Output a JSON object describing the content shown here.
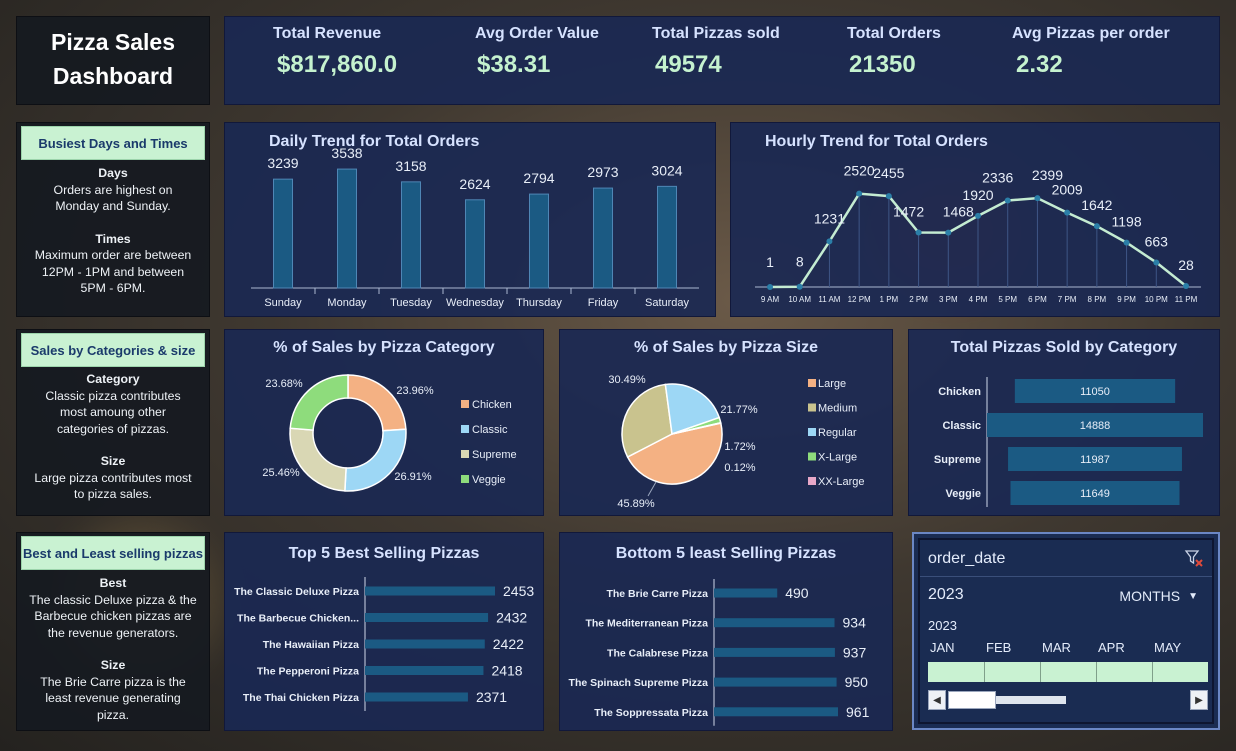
{
  "header": {
    "title_line1": "Pizza Sales",
    "title_line2": "Dashboard"
  },
  "kpis": [
    {
      "label": "Total Revenue",
      "value": "$817,860.0"
    },
    {
      "label": "Avg Order Value",
      "value": "$38.31"
    },
    {
      "label": "Total Pizzas sold",
      "value": "49574"
    },
    {
      "label": "Total Orders",
      "value": "21350"
    },
    {
      "label": "Avg Pizzas per order",
      "value": "2.32"
    }
  ],
  "insights": {
    "busiest": {
      "tag": "Busiest Days and Times",
      "h1": "Days",
      "t1": "Orders are highest on Monday and Sunday.",
      "h2": "Times",
      "t2": "Maximum order are  between 12PM - 1PM and between 5PM - 6PM."
    },
    "categories": {
      "tag": "Sales by Categories & size",
      "h1": "Category",
      "t1": "Classic pizza contributes most amoung other categories of pizzas.",
      "h2": "Size",
      "t2": "Large pizza contributes most to pizza sales."
    },
    "best_least": {
      "tag": "Best and Least selling pizzas",
      "h1": "Best",
      "t1": "The classic Deluxe pizza & the Barbecue chicken pizzas are the revenue generators.",
      "h2": "Size",
      "t2": "The Brie Carre pizza is the least revenue generating pizza."
    }
  },
  "colors": {
    "bar": "#1b5a83",
    "bar_edge": "#4f86b5",
    "line": "#c4ecd2",
    "point": "#2b7fa8",
    "chicken": "#f4b183",
    "classic": "#9dd7f5",
    "supreme": "#d9d7b4",
    "veggie": "#8edc7c",
    "large": "#f4b183",
    "medium": "#c9c38e",
    "regular": "#9dd7f5",
    "xlarge": "#8edc7c",
    "xxlarge": "#e8a8c8"
  },
  "chart_data": [
    {
      "id": "daily",
      "type": "bar",
      "title": "Daily Trend for Total Orders",
      "categories": [
        "Sunday",
        "Monday",
        "Tuesday",
        "Wednesday",
        "Thursday",
        "Friday",
        "Saturday"
      ],
      "values": [
        3239,
        3538,
        3158,
        2624,
        2794,
        2973,
        3024
      ],
      "data_labels": true
    },
    {
      "id": "hourly",
      "type": "line",
      "title": "Hourly Trend for Total Orders",
      "categories": [
        "9 AM",
        "10 AM",
        "11 AM",
        "12 PM",
        "1 PM",
        "2 PM",
        "3 PM",
        "4 PM",
        "5 PM",
        "6 PM",
        "7 PM",
        "8 PM",
        "9 PM",
        "10 PM",
        "11 PM"
      ],
      "values": [
        1,
        8,
        1231,
        2520,
        2455,
        1472,
        1468,
        1920,
        2336,
        2399,
        2009,
        1642,
        1198,
        663,
        28
      ],
      "data_labels": true
    },
    {
      "id": "category",
      "type": "pie",
      "variant": "donut",
      "title": "% of Sales by  Pizza Category",
      "labels": [
        "Chicken",
        "Classic",
        "Supreme",
        "Veggie"
      ],
      "values": [
        23.96,
        26.91,
        25.46,
        23.68
      ],
      "display": [
        "23.96%",
        "26.91%",
        "25.46%",
        "23.68%"
      ],
      "legend": "right"
    },
    {
      "id": "size",
      "type": "pie",
      "title": "% of Sales by Pizza Size",
      "labels": [
        "Large",
        "Medium",
        "Regular",
        "X-Large",
        "XX-Large"
      ],
      "values": [
        45.89,
        30.49,
        21.77,
        1.72,
        0.12
      ],
      "display": [
        "45.89%",
        "30.49%",
        "21.77%",
        "1.72%",
        "0.12%"
      ],
      "legend": "right"
    },
    {
      "id": "cat_sold",
      "type": "bar",
      "orientation": "horizontal",
      "title": "Total Pizzas Sold by Category",
      "categories": [
        "Chicken",
        "Classic",
        "Supreme",
        "Veggie"
      ],
      "values": [
        11050,
        14888,
        11987,
        11649
      ]
    },
    {
      "id": "top5",
      "type": "bar",
      "orientation": "horizontal",
      "title": "Top 5 Best Selling Pizzas",
      "categories": [
        "The Classic Deluxe Pizza",
        "The Barbecue Chicken...",
        "The Hawaiian Pizza",
        "The Pepperoni Pizza",
        "The Thai Chicken Pizza"
      ],
      "values": [
        2453,
        2432,
        2422,
        2418,
        2371
      ]
    },
    {
      "id": "bottom5",
      "type": "bar",
      "orientation": "horizontal",
      "title": "Bottom 5 least Selling Pizzas",
      "categories": [
        "The Brie Carre Pizza",
        "The Mediterranean Pizza",
        "The Calabrese Pizza",
        "The Spinach Supreme Pizza",
        "The Soppressata Pizza"
      ],
      "values": [
        490,
        934,
        937,
        950,
        961
      ]
    }
  ],
  "slicer": {
    "field": "order_date",
    "year": "2023",
    "level": "MONTHS",
    "period_year": "2023",
    "months": [
      "JAN",
      "FEB",
      "MAR",
      "APR",
      "MAY"
    ],
    "selected_fraction": 1.0
  }
}
